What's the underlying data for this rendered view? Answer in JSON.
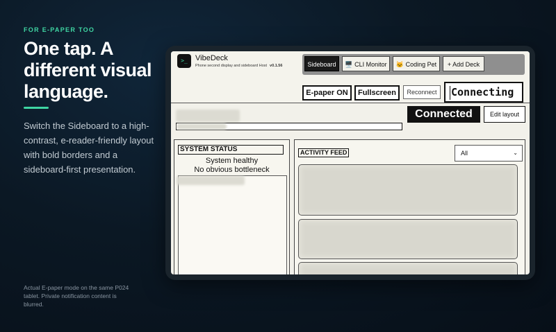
{
  "hero": {
    "eyebrow": "FOR E-PAPER TOO",
    "headline": "One tap. A different visual language.",
    "description": "Switch the Sideboard to a high-contrast, e-reader-friendly layout with bold borders and a sideboard-first presentation.",
    "caption": "Actual E-paper mode on the same P024 tablet. Private notification content is blurred.",
    "accent_color": "#3fd6a3"
  },
  "app": {
    "name": "VibeDeck",
    "subtitle": "Phone second display and sideboard Host",
    "version": "v0.1.56",
    "logo_glyph": ">_"
  },
  "tabs": [
    {
      "label": "Sideboard",
      "icon": "",
      "active": true
    },
    {
      "label": "CLI Monitor",
      "icon": "🖥️",
      "active": false
    },
    {
      "label": "Coding Pet",
      "icon": "🐱",
      "active": false
    },
    {
      "label": "Add Deck",
      "icon": "+",
      "active": false
    }
  ],
  "toolbar": {
    "epaper_label": "E-paper ON",
    "fullscreen_label": "Fullscreen",
    "reconnect_label": "Reconnect",
    "connection_field": "Connecting"
  },
  "header": {
    "connection_badge": "Connected",
    "edit_layout_label": "Edit layout"
  },
  "system_status": {
    "title": "SYSTEM STATUS",
    "headline": "System healthy",
    "detail": "No obvious bottleneck"
  },
  "activity_feed": {
    "title": "ACTIVITY FEED",
    "filter_value": "All"
  }
}
